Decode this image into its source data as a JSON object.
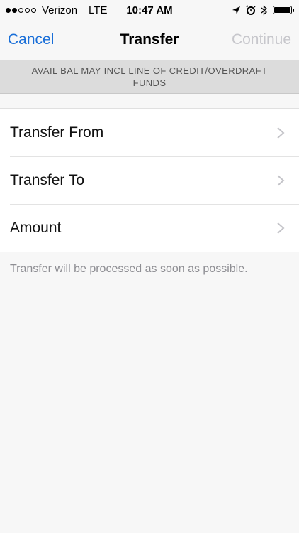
{
  "status_bar": {
    "signal": "●●○○○",
    "carrier": "Verizon",
    "network": "LTE",
    "time": "10:47 AM",
    "icons": [
      "location-arrow-icon",
      "alarm-clock-icon",
      "bluetooth-icon",
      "battery-icon"
    ]
  },
  "nav": {
    "cancel_label": "Cancel",
    "title": "Transfer",
    "continue_label": "Continue"
  },
  "banner": {
    "text": "AVAIL BAL MAY INCL LINE OF CREDIT/OVERDRAFT FUNDS"
  },
  "list": {
    "items": [
      {
        "label": "Transfer From"
      },
      {
        "label": "Transfer To"
      },
      {
        "label": "Amount"
      }
    ]
  },
  "footnote": "Transfer will be processed as soon as possible.",
  "colors": {
    "accent": "#1a6fd8",
    "disabled": "#c7c7cc",
    "banner_bg": "#dcdcdc",
    "footnote": "#8e8e93"
  }
}
